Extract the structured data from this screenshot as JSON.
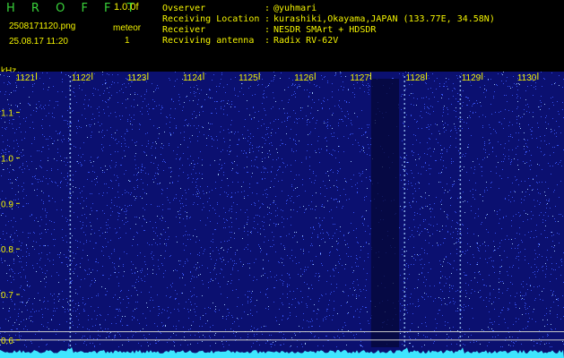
{
  "header": {
    "logo": "H R O F F T",
    "version": "1.0.0f",
    "filename": "2508171120.png",
    "timestamp": "25.08.17 11:20",
    "meteor_label": "meteor",
    "meteor_count": "1",
    "info": [
      {
        "key": "Ovserver",
        "value": "@yuhmari"
      },
      {
        "key": "Receiving Location",
        "value": "kurashiki,Okayama,JAPAN (133.77E, 34.58N)"
      },
      {
        "key": "Receiver",
        "value": "NESDR SMArt + HDSDR"
      },
      {
        "key": "Recviving antenna",
        "value": "Radix RV-62V"
      }
    ]
  },
  "chart_data": {
    "type": "heatmap",
    "y_unit": "kHz",
    "x_ticks": [
      "1121",
      "1122",
      "1123",
      "1124",
      "1125",
      "1126",
      "1127",
      "1128",
      "1129",
      "1130"
    ],
    "y_ticks": [
      1.1,
      1.0,
      0.9,
      0.8,
      0.7,
      0.6
    ],
    "y_ticks_labels": [
      "1.1",
      "1.0",
      "0.9",
      "0.8",
      "0.7",
      "0.6"
    ],
    "ylim": [
      0.58,
      1.17
    ],
    "x_range": [
      1120.5,
      1130.3
    ],
    "dark_band_x": [
      1127.0,
      1127.5
    ],
    "bright_vertical_lines_x": [
      1121.6,
      1127.6,
      1128.6
    ],
    "meteor_count": 1,
    "colors": {
      "background": "#0b1070",
      "noise": "#3d5cff",
      "noise_bright": "#a7d2ff",
      "dark_band": "#050735",
      "baseline": "#3ee6ff",
      "ref_lines": "#c9c9c9",
      "axis_text": "#f2f200"
    }
  }
}
